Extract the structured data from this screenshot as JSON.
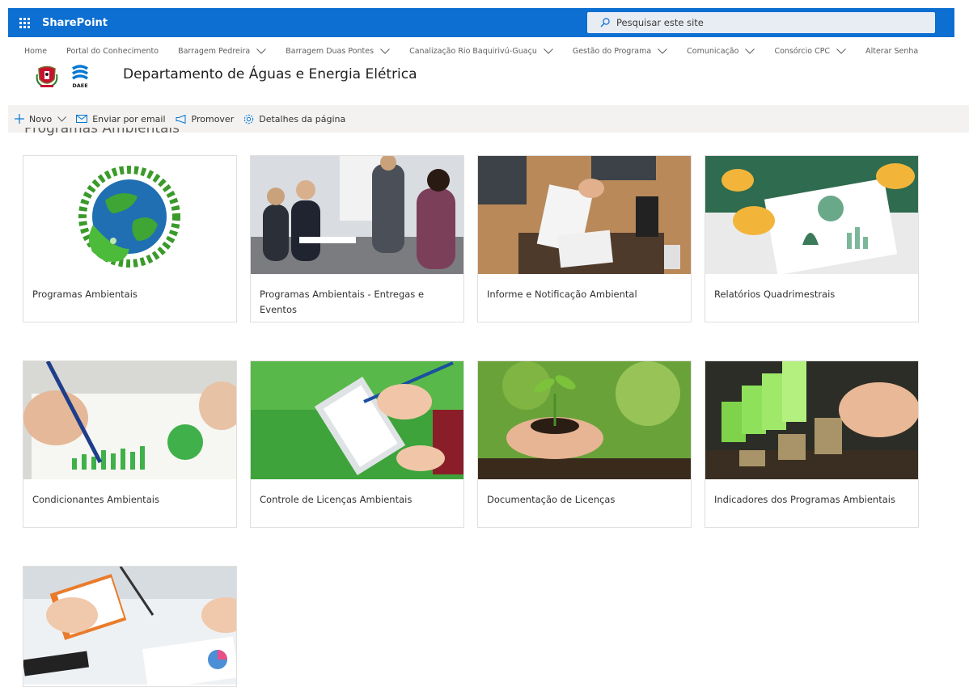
{
  "suite": {
    "app_name": "SharePoint",
    "search_placeholder": "Pesquisar este site"
  },
  "nav": {
    "items": [
      {
        "label": "Home",
        "has_menu": false
      },
      {
        "label": "Portal do Conhecimento",
        "has_menu": false
      },
      {
        "label": "Barragem Pedreira",
        "has_menu": true
      },
      {
        "label": "Barragem Duas Pontes",
        "has_menu": true
      },
      {
        "label": "Canalização Rio Baquirivú-Guaçu",
        "has_menu": true
      },
      {
        "label": "Gestão do Programa",
        "has_menu": true
      },
      {
        "label": "Comunicação",
        "has_menu": true
      },
      {
        "label": "Consórcio CPC",
        "has_menu": true
      },
      {
        "label": "Alterar Senha",
        "has_menu": false
      }
    ]
  },
  "site": {
    "title": "Departamento de Águas e Energia Elétrica",
    "logo_text": "DAEE"
  },
  "commandbar": {
    "new_label": "Novo",
    "email_label": "Enviar por email",
    "promote_label": "Promover",
    "details_label": "Detalhes da página"
  },
  "section": {
    "title": "Programas Ambientais"
  },
  "tiles": [
    {
      "label": "Programas Ambientais",
      "image": "green-globe"
    },
    {
      "label": "Programas Ambientais - Entregas e Eventos",
      "image": "business-meeting"
    },
    {
      "label": "Informe e Notificação Ambiental",
      "image": "document-signing"
    },
    {
      "label": "Relatórios Quadrimestrais",
      "image": "report-charts"
    },
    {
      "label": "Condicionantes Ambientais",
      "image": "writing-on-charts"
    },
    {
      "label": "Controle de Licenças Ambientais",
      "image": "clipboard-grass"
    },
    {
      "label": "Documentação de Licenças",
      "image": "seedling-in-hands"
    },
    {
      "label": "Indicadores dos Programas Ambientais",
      "image": "growth-bars-coins"
    },
    {
      "label": "",
      "image": "desk-charts"
    }
  ],
  "colors": {
    "suitebar": "#0c6fd1",
    "accent": "#0078d4",
    "commandbar_bg": "#f3f2f1"
  }
}
